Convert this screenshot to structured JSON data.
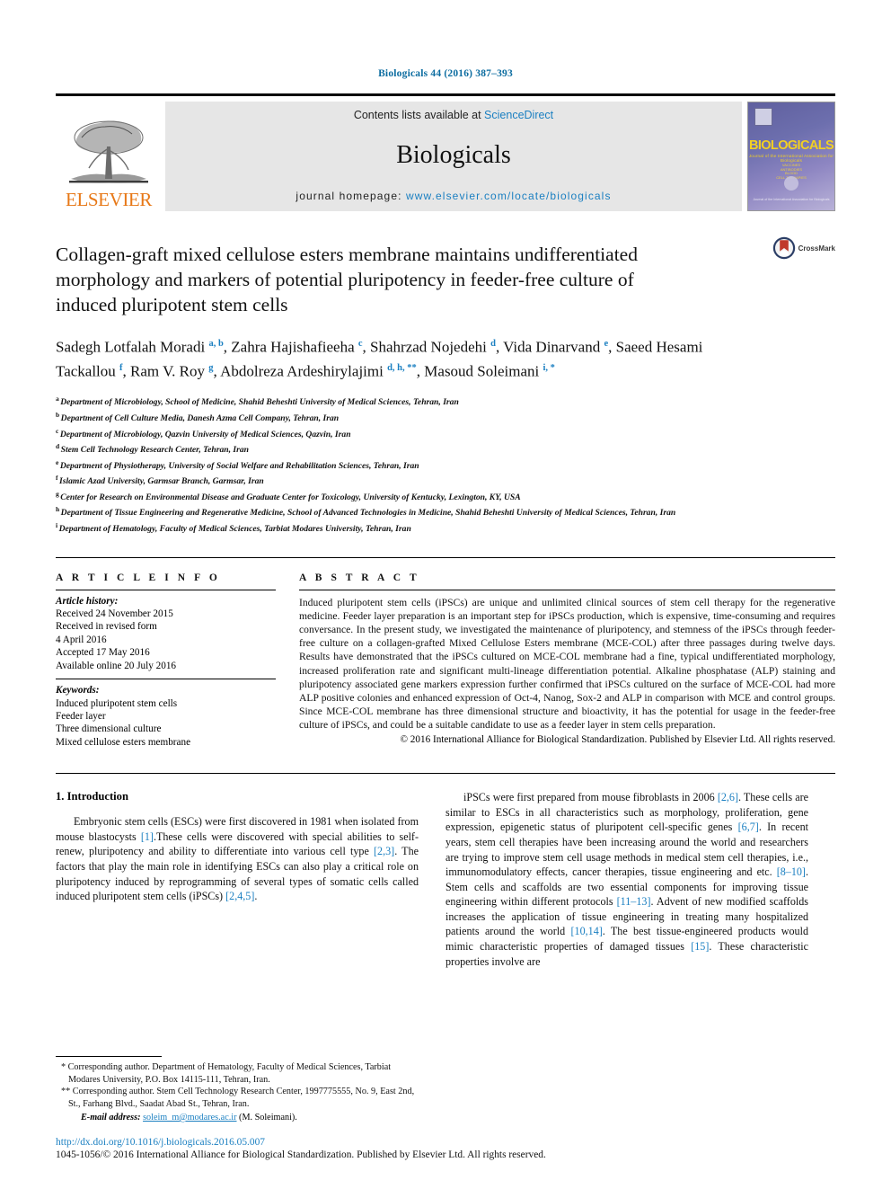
{
  "running_head": "Biologicals 44 (2016) 387–393",
  "masthead": {
    "publisher": "ELSEVIER",
    "contents_prefix": "Contents lists available at ",
    "contents_link": "ScienceDirect",
    "journal_title": "Biologicals",
    "homepage_prefix": "journal homepage: ",
    "homepage_url": "www.elsevier.com/locate/biologicals",
    "cover_title": "BIOLOGICALS",
    "cover_subtitle": "Journal of the International Association for Biologicals",
    "cover_lines": [
      "VACCINES",
      "ANTIBODIES",
      "BLOOD",
      "CELL THERAPIES"
    ],
    "cover_footer": "Journal of the International Association for Biologicals"
  },
  "crossmark": {
    "label": "CrossMark",
    "icon": "crossmark-icon"
  },
  "article": {
    "title": "Collagen-graft mixed cellulose esters membrane maintains undifferentiated morphology and markers of potential pluripotency in feeder-free culture of induced pluripotent stem cells",
    "authors_html": "Sadegh Lotfalah Moradi <sup>a, b</sup>, Zahra Hajishafieeha <sup>c</sup>, Shahrzad Nojedehi <sup>d</sup>, Vida Dinarvand <sup>e</sup>, Saeed Hesami Tackallou <sup>f</sup>, Ram V. Roy <sup>g</sup>, Abdolreza Ardeshirylajimi <sup>d, h, **</sup>, Masoud Soleimani <sup>i, *</sup>",
    "affiliations": [
      {
        "mark": "a",
        "text": "Department of Microbiology, School of Medicine, Shahid Beheshti University of Medical Sciences, Tehran, Iran"
      },
      {
        "mark": "b",
        "text": "Department of Cell Culture Media, Danesh Azma Cell Company, Tehran, Iran"
      },
      {
        "mark": "c",
        "text": "Department of Microbiology, Qazvin University of Medical Sciences, Qazvin, Iran"
      },
      {
        "mark": "d",
        "text": "Stem Cell Technology Research Center, Tehran, Iran"
      },
      {
        "mark": "e",
        "text": "Department of Physiotherapy, University of Social Welfare and Rehabilitation Sciences, Tehran, Iran"
      },
      {
        "mark": "f",
        "text": "Islamic Azad University, Garmsar Branch, Garmsar, Iran"
      },
      {
        "mark": "g",
        "text": "Center for Research on Environmental Disease and Graduate Center for Toxicology, University of Kentucky, Lexington, KY, USA"
      },
      {
        "mark": "h",
        "text": "Department of Tissue Engineering and Regenerative Medicine, School of Advanced Technologies in Medicine, Shahid Beheshti University of Medical Sciences, Tehran, Iran"
      },
      {
        "mark": "i",
        "text": "Department of Hematology, Faculty of Medical Sciences, Tarbiat Modares University, Tehran, Iran"
      }
    ]
  },
  "article_info": {
    "heading": "A R T I C L E   I N F O",
    "history_label": "Article history:",
    "history": [
      "Received 24 November 2015",
      "Received in revised form",
      "4 April 2016",
      "Accepted 17 May 2016",
      "Available online 20 July 2016"
    ],
    "keywords_label": "Keywords:",
    "keywords": [
      "Induced pluripotent stem cells",
      "Feeder layer",
      "Three dimensional culture",
      "Mixed cellulose esters membrane"
    ]
  },
  "abstract": {
    "heading": "A B S T R A C T",
    "text": "Induced pluripotent stem cells (iPSCs) are unique and unlimited clinical sources of stem cell therapy for the regenerative medicine. Feeder layer preparation is an important step for iPSCs production, which is expensive, time-consuming and requires conversance. In the present study, we investigated the maintenance of pluripotency, and stemness of the iPSCs through feeder-free culture on a collagen-grafted Mixed Cellulose Esters membrane (MCE-COL) after three passages during twelve days. Results have demonstrated that the iPSCs cultured on MCE-COL membrane had a fine, typical undifferentiated morphology, increased proliferation rate and significant multi-lineage differentiation potential. Alkaline phosphatase (ALP) staining and pluripotency associated gene markers expression further confirmed that iPSCs cultured on the surface of MCE-COL had more ALP positive colonies and enhanced expression of Oct-4, Nanog, Sox-2 and ALP in comparison with MCE and control groups. Since MCE-COL membrane has three dimensional structure and bioactivity, it has the potential for usage in the feeder-free culture of iPSCs, and could be a suitable candidate to use as a feeder layer in stem cells preparation.",
    "copyright": "© 2016 International Alliance for Biological Standardization. Published by Elsevier Ltd. All rights reserved."
  },
  "introduction": {
    "heading": "1.  Introduction",
    "left_paragraph_html": "Embryonic stem cells (ESCs) were first discovered in 1981 when isolated from mouse blastocysts <span class=\"ref\">[1]</span>.These cells were discovered with special abilities to self-renew, pluripotency and ability to differentiate into various cell type <span class=\"ref\">[2,3]</span>. The factors that play the main role in identifying ESCs can also play a critical role on pluripotency induced by reprogramming of several types of somatic cells called induced pluripotent stem cells (iPSCs) <span class=\"ref\">[2,4,5]</span>.",
    "right_paragraph_html": "iPSCs were first prepared from mouse fibroblasts in 2006 <span class=\"ref\">[2,6]</span>. These cells are similar to ESCs in all characteristics such as morphology, proliferation, gene expression, epigenetic status of pluripotent cell-specific genes <span class=\"ref\">[6,7]</span>. In recent years, stem cell therapies have been increasing around the world and researchers are trying to improve stem cell usage methods in medical stem cell therapies, i.e., immunomodulatory effects, cancer therapies, tissue engineering and etc. <span class=\"ref\">[8–10]</span>. Stem cells and scaffolds are two essential components for improving tissue engineering within different protocols <span class=\"ref\">[11–13]</span>. Advent of new modified scaffolds increases the application of tissue engineering in treating many hospitalized patients around the world <span class=\"ref\">[10,14]</span>. The best tissue-engineered products would mimic characteristic properties of damaged tissues <span class=\"ref\">[15]</span>. These characteristic properties involve are"
  },
  "footnotes": {
    "note1": "*  Corresponding author. Department of Hematology, Faculty of Medical Sciences, Tarbiat Modares University, P.O. Box 14115-111, Tehran, Iran.",
    "note2": "**  Corresponding author. Stem Cell Technology Research Center, 1997775555, No. 9, East 2nd, St., Farhang Blvd., Saadat Abad St., Tehran, Iran.",
    "email_label": "E-mail address:",
    "email": "soleim_m@modares.ac.ir",
    "email_owner": "(M. Soleimani)."
  },
  "doc_footer": {
    "doi": "http://dx.doi.org/10.1016/j.biologicals.2016.05.007",
    "copyright": "1045-1056/© 2016 International Alliance for Biological Standardization. Published by Elsevier Ltd. All rights reserved."
  },
  "colors": {
    "link": "#1a7fc1",
    "running_head": "#0b6ca0",
    "elsevier_orange": "#e77817",
    "cover_yellow": "#f2d023",
    "banner_gray": "#e6e6e6"
  }
}
